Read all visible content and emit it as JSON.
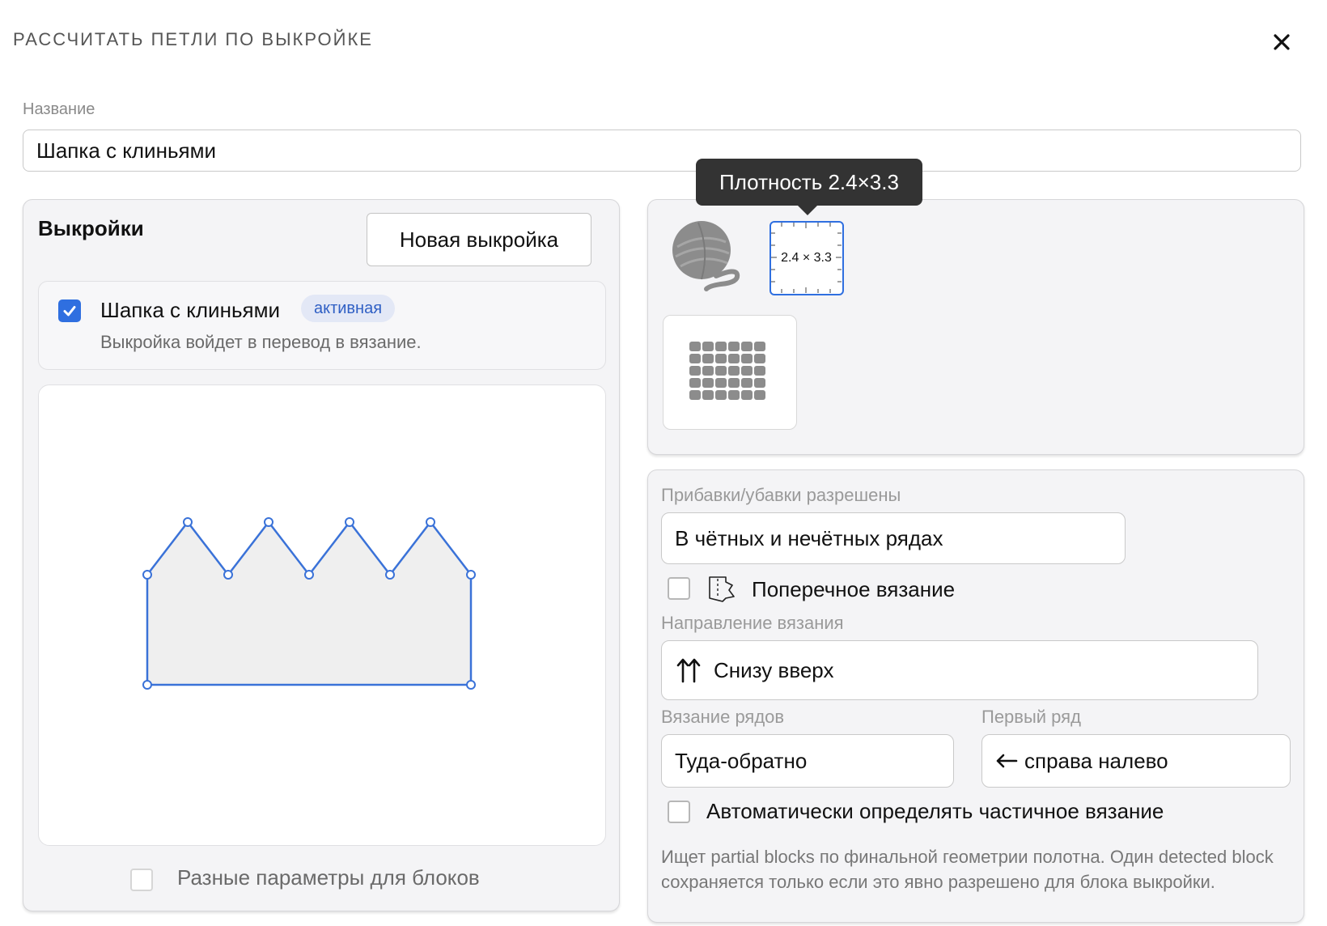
{
  "dialog": {
    "title": "РАССЧИТАТЬ ПЕТЛИ ПО ВЫКРОЙКЕ"
  },
  "name_field": {
    "label": "Название",
    "value": "Шапка с клиньями"
  },
  "patterns": {
    "title": "Выкройки",
    "new_button_label": "Новая выкройка",
    "items": [
      {
        "name": "Шапка с клиньями",
        "badge": "активная",
        "description": "Выкройка войдет в перевод в вязание.",
        "checked": true
      }
    ],
    "different_params_label": "Разные параметры для блоков"
  },
  "tooltip": {
    "text": "Плотность 2.4×3.3"
  },
  "density_tile": {
    "label": "2.4 × 3.3"
  },
  "settings": {
    "increases_label": "Прибавки/убавки разрешены",
    "increases_value": "В чётных и нечётных рядах",
    "transverse_label": "Поперечное вязание",
    "direction_label": "Направление вязания",
    "direction_value": "Снизу вверх",
    "rows_label": "Вязание рядов",
    "rows_value": "Туда-обратно",
    "first_row_label": "Первый ряд",
    "first_row_value": "справа налево",
    "auto_partial_label": "Автоматически определять частичное вязание",
    "help_text": "Ищет partial blocks по финальной геометрии полотна. Один detected block сохраняется только если это явно разрешено для блока выкройки."
  },
  "icons": {
    "close": "close-icon",
    "checkbox": "check-icon",
    "yarn": "yarn-ball-icon",
    "stitches": "stitch-grid-icon",
    "transverse": "transverse-knitting-icon",
    "direction": "arrows-up-icon",
    "first_row": "arrow-left-icon"
  },
  "colors": {
    "accent": "#2f6fe0",
    "shape_fill": "#efefef",
    "shape_stroke": "#3a72d8",
    "tooltip_bg": "#333333",
    "badge_bg": "#e3e8f6",
    "badge_text": "#2f5fc4"
  }
}
